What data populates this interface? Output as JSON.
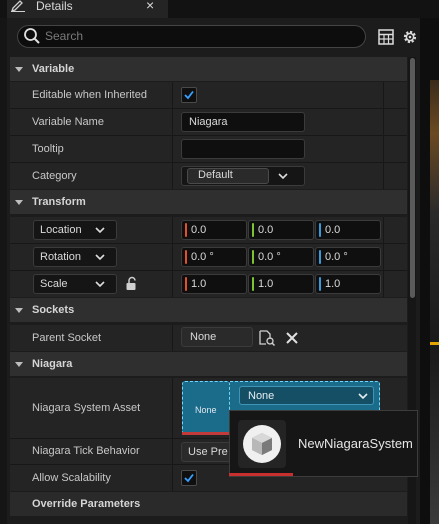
{
  "tab": {
    "title": "Details",
    "close_glyph": "×",
    "icon": "pencil-icon"
  },
  "search": {
    "placeholder": "Search",
    "value": ""
  },
  "toolbar": {
    "table_icon": "table-view-icon",
    "settings_icon": "gear-icon"
  },
  "sections": {
    "variable": {
      "title": "Variable",
      "editable_label": "Editable when Inherited",
      "editable_checked": true,
      "name_label": "Variable Name",
      "name_value": "Niagara",
      "tooltip_label": "Tooltip",
      "tooltip_value": "",
      "category_label": "Category",
      "category_value": "Default"
    },
    "transform": {
      "title": "Transform",
      "location_label": "Location",
      "location": [
        "0.0",
        "0.0",
        "0.0"
      ],
      "rotation_label": "Rotation",
      "rotation": [
        "0.0 °",
        "0.0 °",
        "0.0 °"
      ],
      "scale_label": "Scale",
      "scale": [
        "1.0",
        "1.0",
        "1.0"
      ],
      "scale_lock_icon": "unlocked-padlock-icon"
    },
    "sockets": {
      "title": "Sockets",
      "parent_label": "Parent Socket",
      "parent_value": "None",
      "browse_icon": "socket-browse-icon",
      "clear_icon": "close-icon"
    },
    "niagara": {
      "title": "Niagara",
      "asset_label": "Niagara System Asset",
      "asset_thumb_text": "None",
      "asset_value": "None",
      "tick_label": "Niagara Tick Behavior",
      "tick_value": "Use Pre",
      "scalability_label": "Allow Scalability",
      "scalability_checked": true
    },
    "override": {
      "title": "Override Parameters"
    }
  },
  "drag_tooltip": {
    "label": "NewNiagaraSystem",
    "icon": "niagara-system-icon"
  },
  "colors": {
    "axis_x": "#e0522b",
    "axis_y": "#7ec432",
    "axis_z": "#3a9ad9",
    "accent_drop": "#6fd6ff",
    "checkbox_tick": "#3aa0ff"
  }
}
